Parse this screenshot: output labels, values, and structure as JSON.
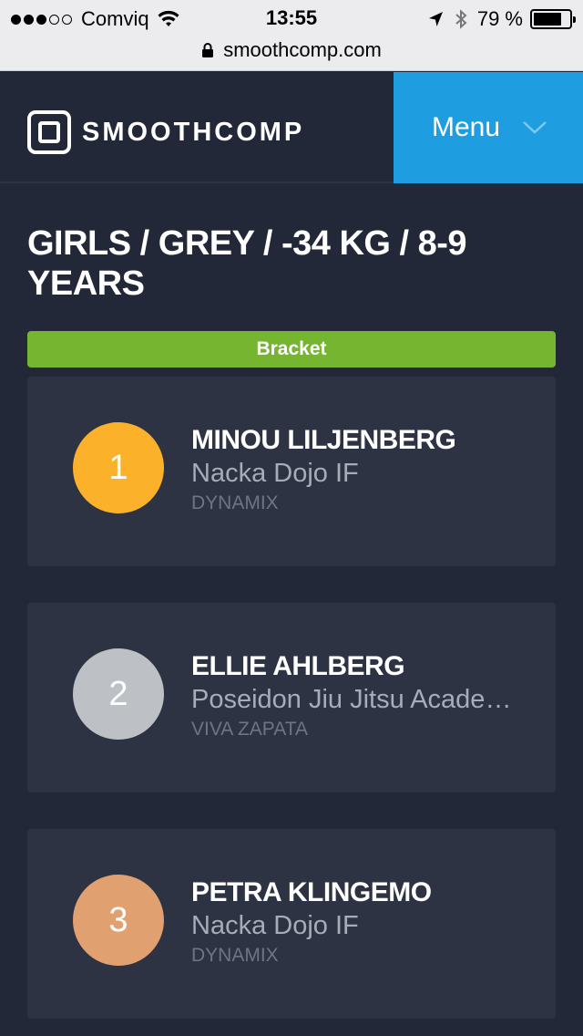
{
  "status_bar": {
    "carrier": "Comviq",
    "time": "13:55",
    "battery_percent": "79 %",
    "battery_level": 0.79,
    "signal_bars_filled": 3,
    "signal_bars_total": 5
  },
  "url_bar": {
    "domain": "smoothcomp.com"
  },
  "header": {
    "logo_text": "SMOOTHCOMP",
    "menu_label": "Menu"
  },
  "page": {
    "title": "GIRLS / GREY / -34 KG / 8-9 YEARS",
    "bracket_label": "Bracket"
  },
  "results": [
    {
      "place": "1",
      "name": "MINOU LILJENBERG",
      "club": "Nacka Dojo IF",
      "team": "DYNAMIX",
      "color": "#fbb22a"
    },
    {
      "place": "2",
      "name": "ELLIE AHLBERG",
      "club": "Poseidon Jiu Jitsu Academy",
      "team": "VIVA ZAPATA",
      "color": "#bdc1c6"
    },
    {
      "place": "3",
      "name": "PETRA KLINGEMO",
      "club": "Nacka Dojo IF",
      "team": "DYNAMIX",
      "color": "#e1a070"
    }
  ],
  "colors": {
    "background": "#222838",
    "card": "#2d3343",
    "menu_accent": "#1e9ee0",
    "bracket_green": "#76b52f"
  }
}
